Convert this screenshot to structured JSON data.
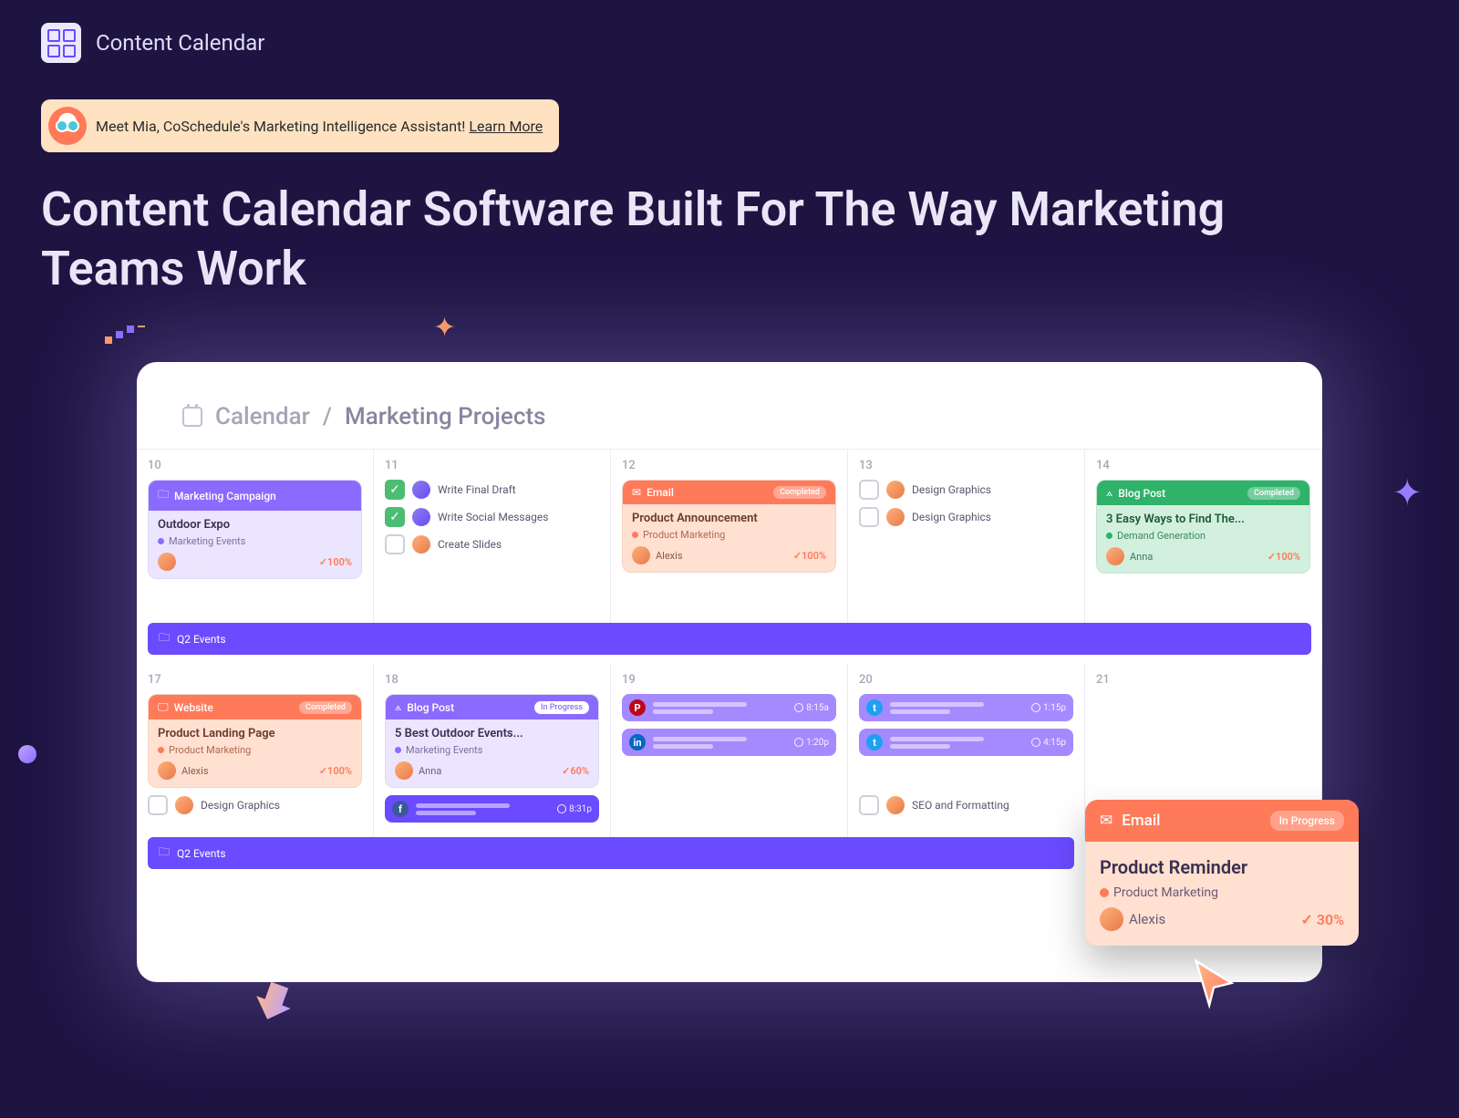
{
  "header": {
    "product": "Content Calendar"
  },
  "banner": {
    "text": "Meet Mia, CoSchedule's Marketing Intelligence Assistant! ",
    "link": "Learn More"
  },
  "hero": "Content Calendar Software Built For The Way Marketing Teams Work",
  "breadcrumb": {
    "root": "Calendar",
    "sep": "/",
    "page": "Marketing Projects"
  },
  "spanLabel": "Q2 Events",
  "days": {
    "r1": [
      "10",
      "11",
      "12",
      "13",
      "14"
    ],
    "r2": [
      "17",
      "18",
      "19",
      "20",
      "21"
    ]
  },
  "cards": {
    "marketingCampaign": {
      "type": "Marketing Campaign",
      "title": "Outdoor Expo",
      "cat": "Marketing Events",
      "owner": "Alexis",
      "pct": "100%"
    },
    "email": {
      "type": "Email",
      "badge": "Completed",
      "title": "Product Announcement",
      "cat": "Product Marketing",
      "owner": "Alexis",
      "pct": "100%"
    },
    "blog1": {
      "type": "Blog Post",
      "badge": "Completed",
      "title": "3 Easy Ways to Find The...",
      "cat": "Demand Generation",
      "owner": "Anna",
      "pct": "100%"
    },
    "website": {
      "type": "Website",
      "badge": "Completed",
      "title": "Product Landing Page",
      "cat": "Product Marketing",
      "owner": "Alexis",
      "pct": "100%"
    },
    "blog2": {
      "type": "Blog Post",
      "badge": "In Progress",
      "title": "5 Best Outdoor Events...",
      "cat": "Marketing Events",
      "owner": "Anna",
      "pct": "60%"
    }
  },
  "tasks": {
    "d11a": "Write Final Draft",
    "d11b": "Write Social Messages",
    "d11c": "Create Slides",
    "d13a": "Design Graphics",
    "d13b": "Design Graphics",
    "d17a": "Design Graphics",
    "d20a": "SEO and Formatting"
  },
  "social": {
    "fbTime": "8:31p",
    "pinTime": "8:15a",
    "liTime": "1:20p",
    "tw1Time": "1:15p",
    "tw2Time": "4:15p"
  },
  "float": {
    "type": "Email",
    "badge": "In Progress",
    "title": "Product Reminder",
    "cat": "Product Marketing",
    "owner": "Alexis",
    "pct": "30%"
  }
}
